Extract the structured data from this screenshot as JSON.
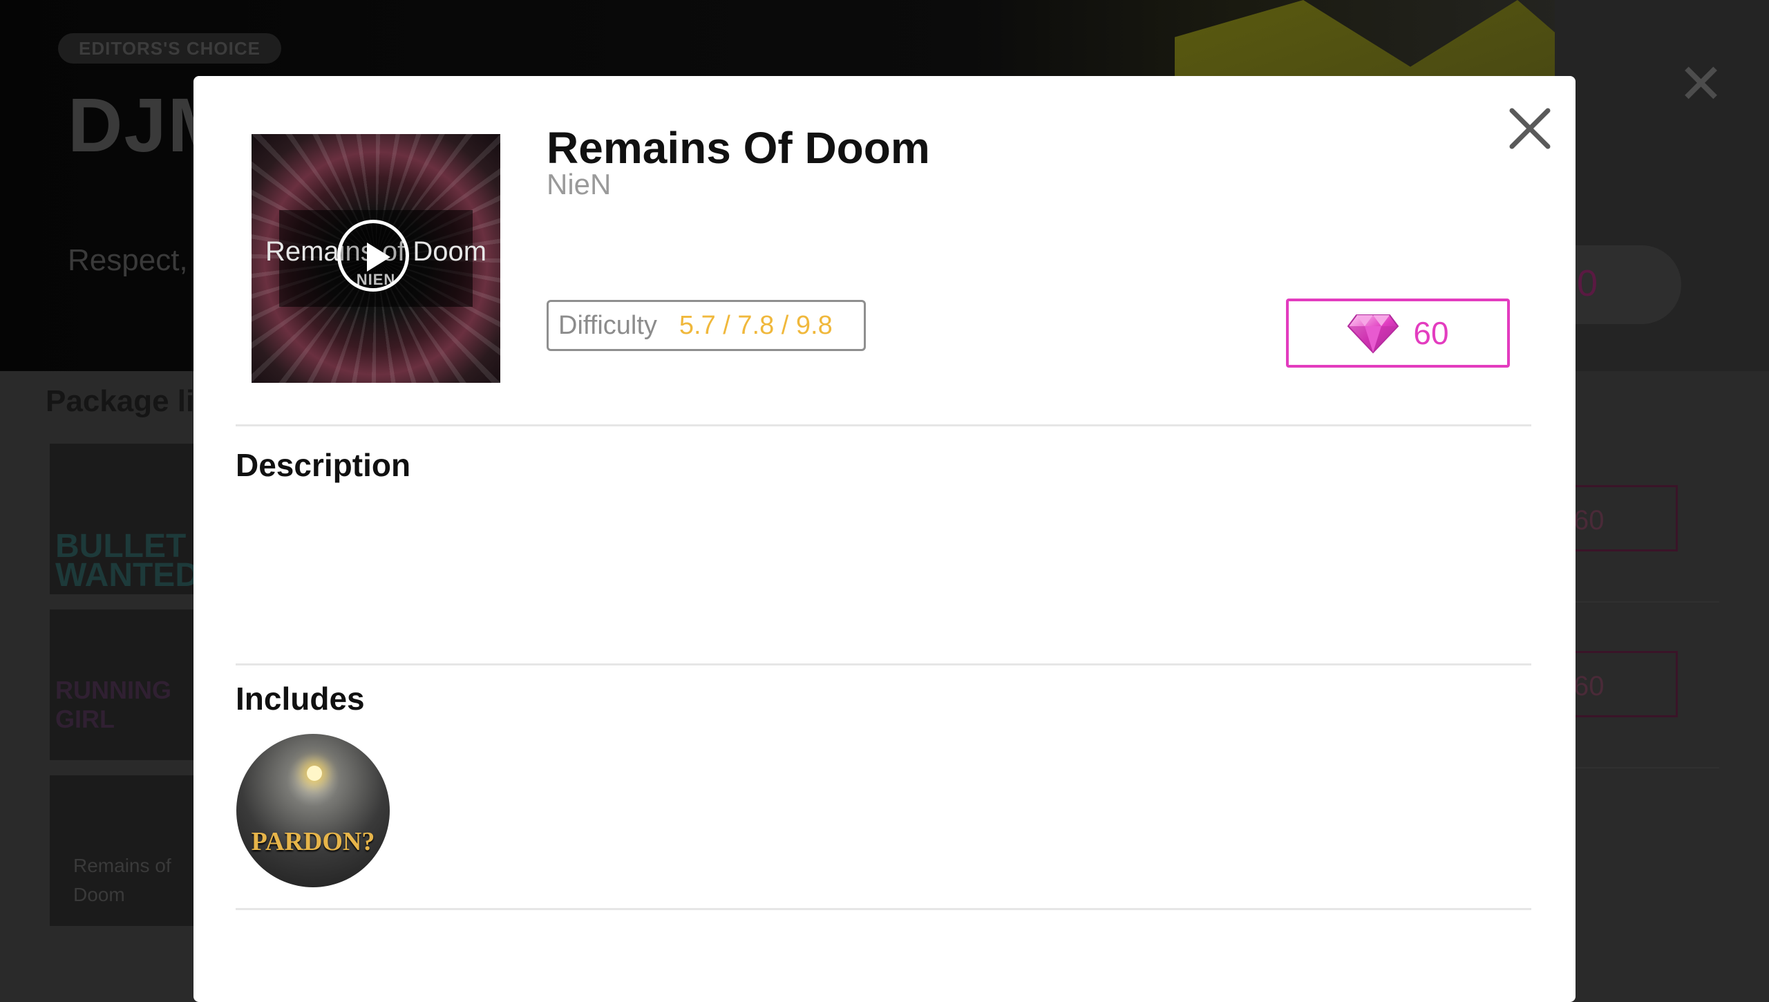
{
  "background": {
    "badge": "EDITORS'S CHOICE",
    "title": "DJM",
    "subtitle": "Respect,",
    "pill_price": "0",
    "section_title": "Package li",
    "thumb1_text": "BULLET WANTED",
    "thumb2_text": "RUNNING GIRL",
    "thumb3_text": "Remains of Doom",
    "row_price": "60"
  },
  "modal": {
    "song_title": "Remains Of Doom",
    "artist": "NieN",
    "cover_title": "Remains of Doom",
    "cover_subtitle": "NIEN",
    "difficulty_label": "Difficulty",
    "difficulty_values": "5.7 / 7.8 / 9.8",
    "price": "60",
    "description_heading": "Description",
    "description_text": "",
    "includes_heading": "Includes",
    "includes": [
      {
        "label": "PARDON?"
      }
    ]
  },
  "colors": {
    "accent_pink": "#e33cbf",
    "difficulty_yellow": "#f0b83c"
  },
  "icons": [
    "play-icon",
    "gem-icon",
    "close-icon"
  ]
}
